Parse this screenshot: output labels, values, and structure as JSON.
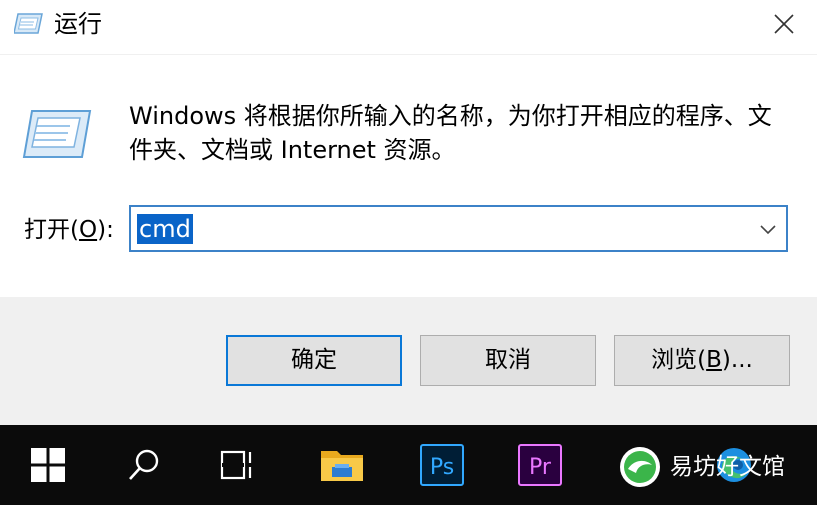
{
  "window": {
    "title": "运行",
    "close_glyph": "✕"
  },
  "main": {
    "description": "Windows 将根据你所输入的名称，为你打开相应的程序、文件夹、文档或 Internet 资源。",
    "open_label_prefix": "打开(",
    "open_label_key": "O",
    "open_label_suffix": "):",
    "command_value": "cmd"
  },
  "buttons": {
    "ok_label": "确定",
    "cancel_label": "取消",
    "browse_prefix": "浏览(",
    "browse_key": "B",
    "browse_suffix": ")..."
  },
  "taskbar": {
    "items": [
      "windows-start-icon",
      "search-icon",
      "task-view-icon",
      "file-explorer-icon",
      "photoshop-icon",
      "premiere-icon",
      "edge-icon"
    ],
    "photoshop_text": "Ps",
    "premiere_text": "Pr",
    "watermark_text": "易坊好文馆"
  },
  "colors": {
    "accent": "#0a78d7",
    "selection": "#0a64c8",
    "footer_bg": "#f0f0f0",
    "taskbar_bg": "#0b0b0b"
  }
}
